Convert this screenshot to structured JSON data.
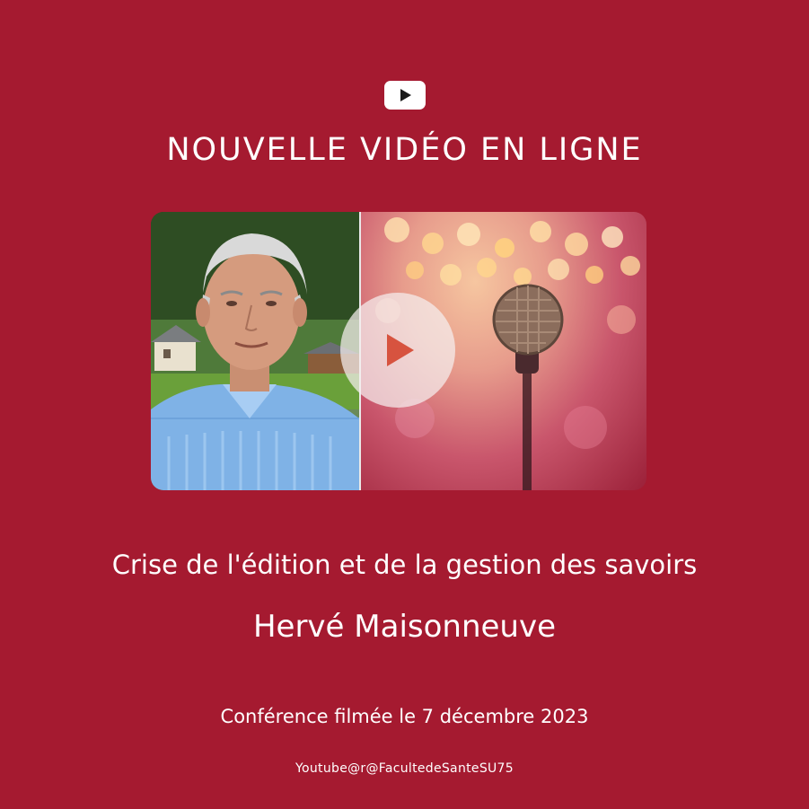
{
  "header": {
    "icon": "youtube-play-icon",
    "title": "NOUVELLE VIDÉO EN LIGNE"
  },
  "video": {
    "thumbnail_left": "speaker-portrait",
    "thumbnail_right": "microphone-bokeh",
    "play_icon": "play-icon"
  },
  "content": {
    "subtitle": "Crise de l'édition et de la gestion des savoirs",
    "speaker": "Hervé Maisonneuve",
    "date_line": "Conférence filmée le 7 décembre 2023",
    "handle": "Youtube@r@FacultedeSanteSU75"
  },
  "colors": {
    "background": "#a51a30",
    "text": "#ffffff",
    "play_accent": "#d7533f"
  }
}
